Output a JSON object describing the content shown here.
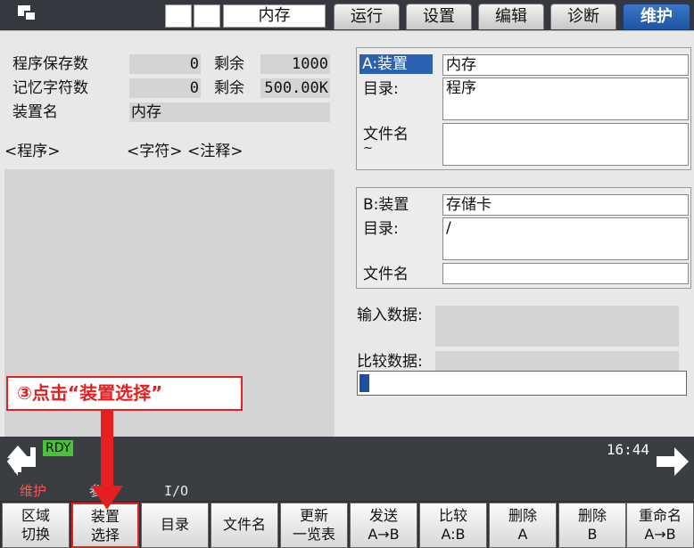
{
  "topbar": {
    "device_label": "内存",
    "tabs": [
      "运行",
      "设置",
      "编辑",
      "诊断",
      "维护"
    ],
    "active_tab": "维护"
  },
  "left": {
    "row1_label": "程序保存数",
    "row1_value": "0",
    "row1_remain_label": "剩余",
    "row1_remain_value": "1000",
    "row2_label": "记忆字符数",
    "row2_value": "0",
    "row2_remain_label": "剩余",
    "row2_remain_value": "500.00K",
    "device_name_label": "装置名",
    "device_name_value": "内存",
    "col_program": "<程序>",
    "col_chars": "<字符>",
    "col_comment": "<注释>"
  },
  "panelA": {
    "device_label": "A:装置",
    "device_value": "内存",
    "dir_label": "目录:",
    "dir_value": "程序",
    "file_label": "文件名",
    "file_tilde": "~",
    "file_value": ""
  },
  "panelB": {
    "device_label": "B:装置",
    "device_value": "存储卡",
    "dir_label": "目录:",
    "dir_value": "/",
    "file_label": "文件名",
    "file_value": ""
  },
  "data": {
    "input_label": "输入数据:",
    "compare_label": "比较数据:"
  },
  "progress": {
    "value": 0.03
  },
  "annotation": {
    "text": "③点击“装置选择”"
  },
  "status": {
    "rdy": "RDY",
    "time": "16:44"
  },
  "menupath": {
    "item1": "维护",
    "item2": "参数",
    "item3": "I/O"
  },
  "fkeys": [
    {
      "l1": "区域",
      "l2": "切换"
    },
    {
      "l1": "装置",
      "l2": "选择"
    },
    {
      "l1": "目录",
      "l2": ""
    },
    {
      "l1": "文件名",
      "l2": ""
    },
    {
      "l1": "更新",
      "l2": "一览表"
    },
    {
      "l1": "发送",
      "l2": "A→B"
    },
    {
      "l1": "比较",
      "l2": "A:B"
    },
    {
      "l1": "删除",
      "l2": "A"
    },
    {
      "l1": "删除",
      "l2": "B"
    },
    {
      "l1": "重命名",
      "l2": "A→B"
    }
  ],
  "colors": {
    "active_tab": "#2a62b0",
    "annotation": "#e62020",
    "rdy": "#49c23a",
    "progress": "#1e4fa0"
  }
}
